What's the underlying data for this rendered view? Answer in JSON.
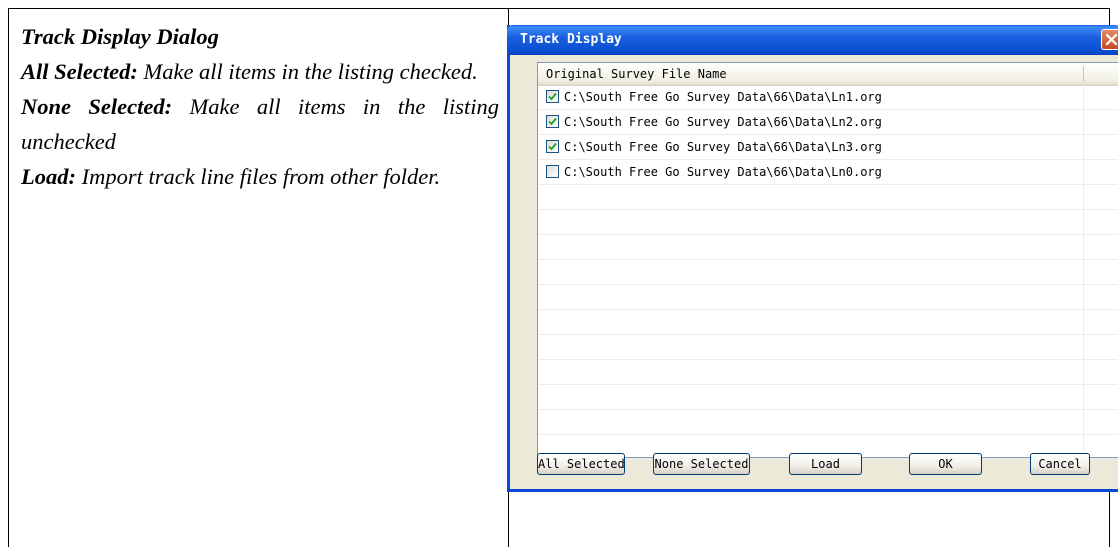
{
  "doc": {
    "heading": "Track Display Dialog",
    "items": [
      {
        "term": "All Selected:",
        "desc": " Make all items in the listing checked."
      },
      {
        "term": "None Selected:",
        "desc": " Make all items in the listing unchecked"
      },
      {
        "term": "Load:",
        "desc": " Import track line files from other folder."
      }
    ]
  },
  "dialog": {
    "title": "Track Display",
    "close_icon": "close-x-icon",
    "column_header": "Original Survey File Name",
    "files": [
      {
        "path": "C:\\South Free Go Survey Data\\66\\Data\\Ln1.org",
        "checked": true
      },
      {
        "path": "C:\\South Free Go Survey Data\\66\\Data\\Ln2.org",
        "checked": true
      },
      {
        "path": "C:\\South Free Go Survey Data\\66\\Data\\Ln3.org",
        "checked": true
      },
      {
        "path": "C:\\South Free Go Survey Data\\66\\Data\\Ln0.org",
        "checked": false
      }
    ],
    "buttons": {
      "all_selected": "All Selected",
      "none_selected": "None Selected",
      "load": "Load",
      "ok": "OK",
      "cancel": "Cancel"
    }
  },
  "colors": {
    "title_bar": "#0a4ed0",
    "dialog_face": "#ece9d8",
    "check_mark": "#21a121"
  }
}
